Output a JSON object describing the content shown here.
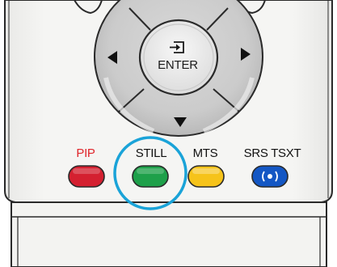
{
  "remote": {
    "enter_label": "ENTER",
    "buttons": [
      {
        "id": "pip",
        "label": "PIP",
        "label_color": "#e0262b",
        "button_color": "#d42030"
      },
      {
        "id": "still",
        "label": "STILL",
        "label_color": "#111111",
        "button_color": "#1ea04a",
        "highlighted": true
      },
      {
        "id": "mts",
        "label": "MTS",
        "label_color": "#111111",
        "button_color": "#f6c31a"
      },
      {
        "id": "srs",
        "label": "SRS TSXT",
        "label_color": "#111111",
        "button_color": "#1457c4",
        "icon": "srs-icon"
      }
    ],
    "highlight_color": "#1aa3d8",
    "body_color": "#f0f0ee",
    "icons": [
      "enter-icon",
      "left-arrow-icon",
      "right-arrow-icon",
      "down-arrow-icon",
      "srs-icon"
    ]
  }
}
